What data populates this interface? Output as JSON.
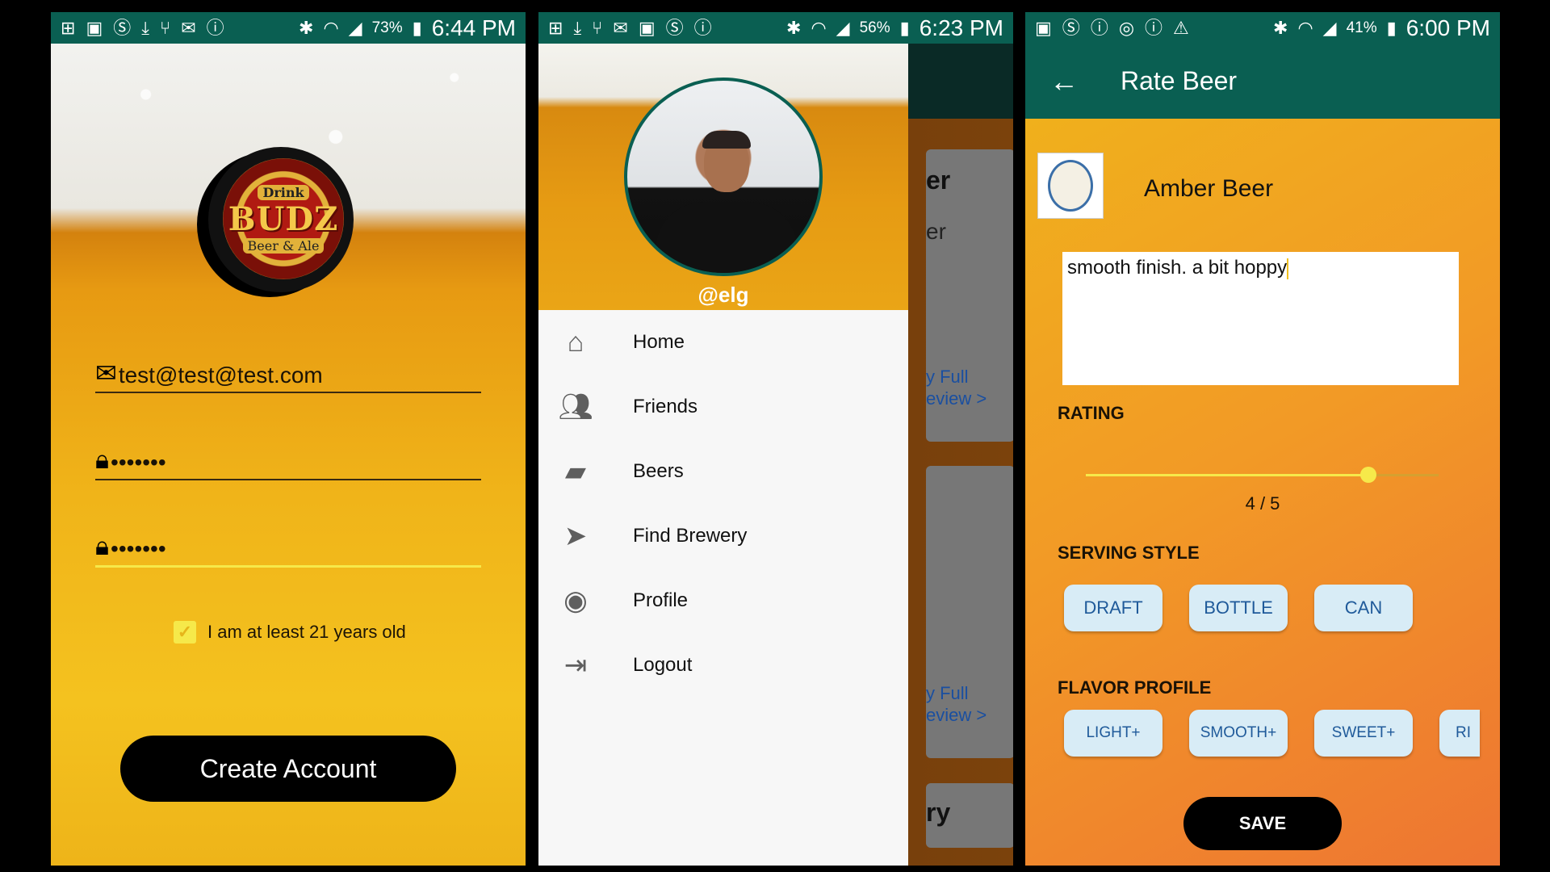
{
  "panel1": {
    "status": {
      "battery": "73%",
      "time": "6:44 PM"
    },
    "logo": {
      "top": "Drink",
      "main": "BUDZ",
      "bottom": "Beer & Ale"
    },
    "email": "test@test@test.com",
    "password": "•••••••",
    "confirm_password": "•••••••",
    "age_checkbox_label": "I am at least 21 years old",
    "create_button": "Create Account",
    "colors": {
      "accent": "#f6e94a",
      "statusbar": "#0a5f52"
    }
  },
  "panel2": {
    "status": {
      "battery": "56%",
      "time": "6:23 PM"
    },
    "username": "@elg",
    "menu": [
      {
        "label": "Home",
        "icon": "home-icon"
      },
      {
        "label": "Friends",
        "icon": "friends-icon"
      },
      {
        "label": "Beers",
        "icon": "beers-icon"
      },
      {
        "label": "Find Brewery",
        "icon": "navigation-icon"
      },
      {
        "label": "Profile",
        "icon": "profile-icon"
      },
      {
        "label": "Logout",
        "icon": "logout-icon"
      }
    ],
    "background_cards": {
      "card1_title": "er",
      "card1_sub": "er",
      "card1_link1": "y Full",
      "card1_link2": "eview >",
      "card2_link1": "y Full",
      "card2_link2": "eview >",
      "card3_title": "ry"
    }
  },
  "panel3": {
    "status": {
      "battery": "41%",
      "time": "6:00 PM"
    },
    "title": "Rate Beer",
    "beer_name": "Amber Beer",
    "review_text": "smooth finish. a bit hoppy",
    "rating_label": "RATING",
    "rating_value": 0.8,
    "rating_text": "4 / 5",
    "serving_label": "SERVING STYLE",
    "serving_options": [
      "DRAFT",
      "BOTTLE",
      "CAN"
    ],
    "flavor_label": "FLAVOR PROFILE",
    "flavor_options": [
      "LIGHT+",
      "SMOOTH+",
      "SWEET+",
      "RI"
    ],
    "save_button": "SAVE"
  }
}
